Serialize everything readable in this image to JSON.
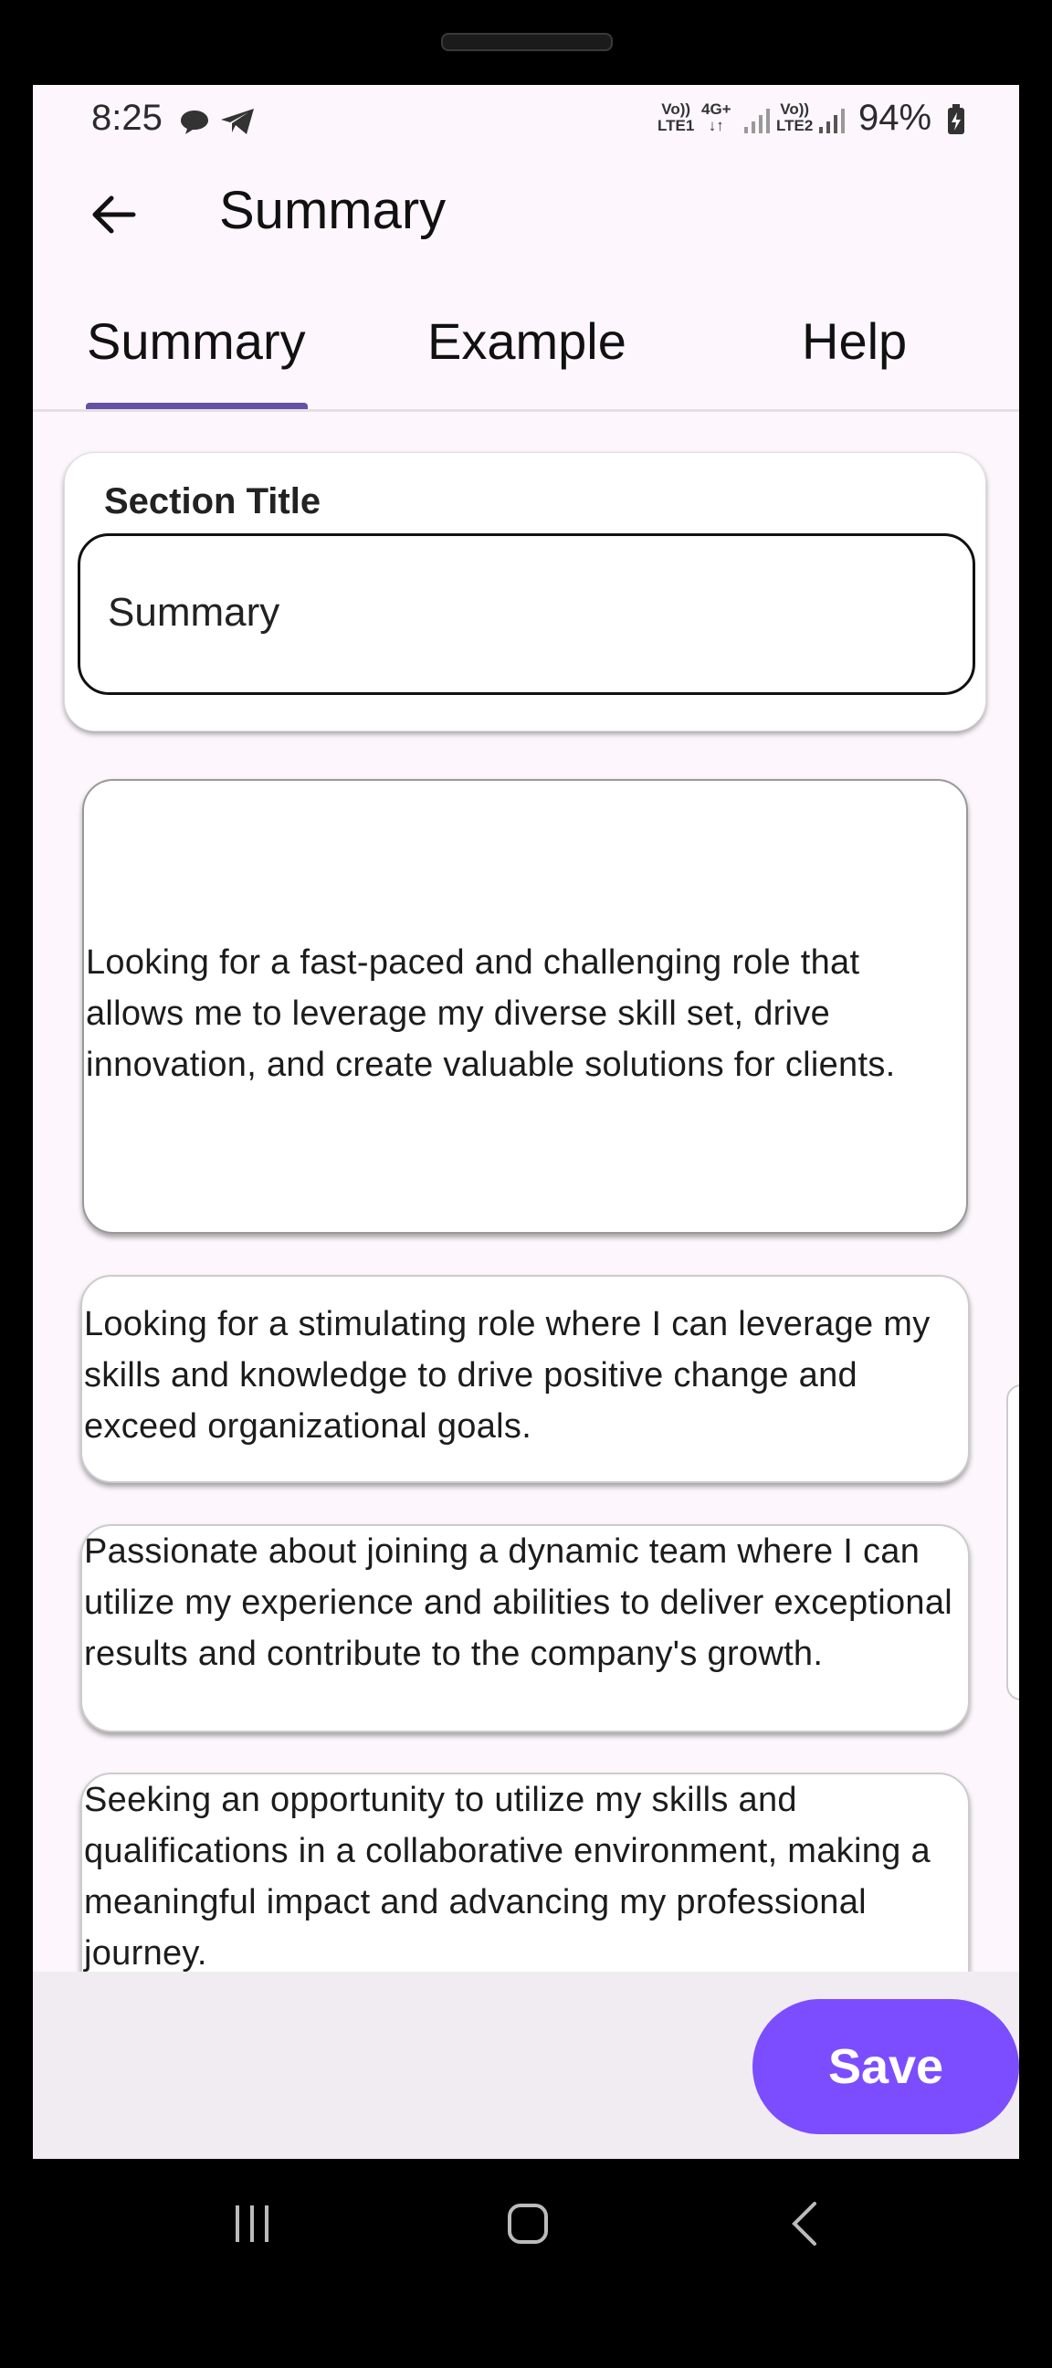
{
  "status_bar": {
    "time": "8:25",
    "sim1_label": "Vo))\nLTE1",
    "net_label": "4G+\n↓↑",
    "sim2_label": "Vo))\nLTE2",
    "battery": "94%"
  },
  "app_bar": {
    "title": "Summary"
  },
  "tabs": [
    {
      "label": "Summary",
      "selected": true
    },
    {
      "label": "Example",
      "selected": false
    },
    {
      "label": "Help",
      "selected": false
    }
  ],
  "section": {
    "label": "Section Title",
    "value": "Summary"
  },
  "options": [
    "Looking for a fast-paced and challenging role that allows me to leverage my diverse skill set, drive innovation, and create valuable solutions for clients.",
    "Looking for a stimulating role where I can leverage my skills and knowledge to drive positive change and exceed organizational goals.",
    "Passionate about joining a dynamic team where I can utilize my experience and abilities to deliver exceptional results and contribute to the company's growth.",
    "Seeking an opportunity to utilize my skills and qualifications in a collaborative environment, making a meaningful impact and advancing my professional journey."
  ],
  "save_label": "Save",
  "colors": {
    "accent": "#7c4dff",
    "tab_indicator": "#6650a4",
    "background": "#fdf7fd"
  }
}
